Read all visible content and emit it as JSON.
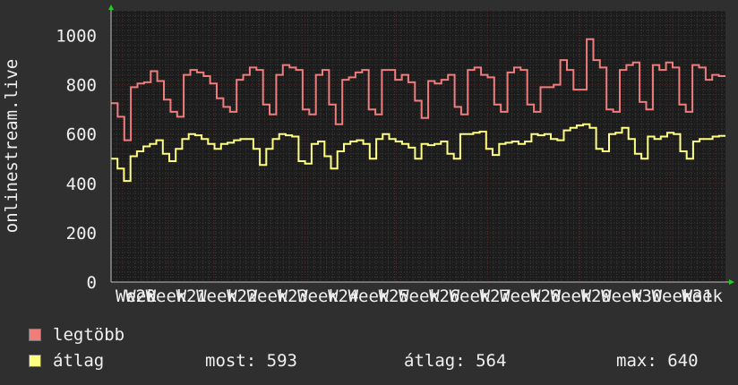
{
  "chart_data": {
    "type": "line",
    "ylabel": "onlinestream.live",
    "ylim": [
      0,
      1100
    ],
    "yticks": [
      0,
      200,
      400,
      600,
      800,
      1000
    ],
    "x_tick_labels": [
      "Week",
      "W20",
      "Week",
      "W21",
      "Week",
      "W22",
      "Week",
      "W23",
      "Week",
      "W24",
      "Week",
      "W25",
      "Week",
      "W26",
      "Week",
      "W27",
      "Week",
      "W28",
      "Week",
      "W29",
      "Week",
      "W30",
      "Week",
      "W31",
      "Week"
    ],
    "grid": true,
    "series": [
      {
        "name": "legtöbb",
        "color": "#f07c7c",
        "values": [
          725,
          670,
          575,
          790,
          805,
          810,
          855,
          815,
          740,
          690,
          670,
          840,
          860,
          850,
          835,
          805,
          745,
          710,
          690,
          820,
          840,
          870,
          860,
          720,
          680,
          840,
          880,
          870,
          860,
          700,
          680,
          840,
          860,
          720,
          640,
          820,
          830,
          850,
          860,
          700,
          680,
          860,
          860,
          820,
          840,
          810,
          735,
          665,
          815,
          805,
          820,
          840,
          710,
          680,
          860,
          870,
          840,
          830,
          720,
          690,
          850,
          870,
          860,
          720,
          690,
          790,
          790,
          800,
          900,
          860,
          780,
          780,
          985,
          900,
          870,
          700,
          690,
          860,
          880,
          890,
          730,
          700,
          880,
          860,
          890,
          870,
          720,
          690,
          880,
          870,
          820,
          840,
          835
        ]
      },
      {
        "name": "átlag",
        "color": "#ffff80",
        "values": [
          500,
          460,
          410,
          510,
          530,
          550,
          560,
          575,
          520,
          490,
          540,
          580,
          600,
          595,
          580,
          560,
          540,
          560,
          565,
          575,
          580,
          580,
          540,
          475,
          540,
          580,
          600,
          595,
          590,
          490,
          480,
          560,
          570,
          510,
          460,
          530,
          560,
          570,
          575,
          560,
          500,
          580,
          600,
          580,
          570,
          560,
          545,
          500,
          560,
          555,
          560,
          570,
          520,
          500,
          600,
          600,
          605,
          610,
          540,
          515,
          560,
          565,
          570,
          560,
          570,
          600,
          595,
          600,
          580,
          575,
          615,
          625,
          635,
          640,
          625,
          540,
          530,
          600,
          605,
          625,
          580,
          520,
          500,
          590,
          580,
          590,
          605,
          600,
          530,
          500,
          570,
          580,
          580,
          590,
          593
        ]
      }
    ]
  },
  "legend": {
    "max_label": "legtöbb",
    "avg_label": "átlag",
    "now": "most: 593",
    "avg": "átlag: 564",
    "max": "max: 640"
  },
  "colors": {
    "background": "#2f2f2f",
    "plot": "#1c1c1c",
    "max_series": "#f07c7c",
    "avg_series": "#ffff80",
    "text": "#f0f0f0"
  }
}
